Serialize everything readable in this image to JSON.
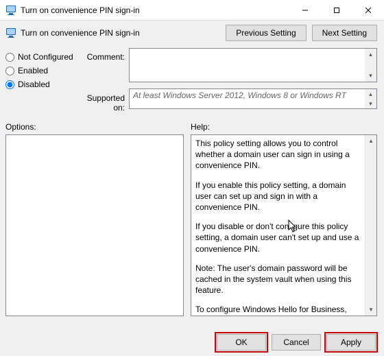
{
  "window": {
    "title": "Turn on convenience PIN sign-in"
  },
  "header": {
    "policy_name": "Turn on convenience PIN sign-in",
    "prev_btn": "Previous Setting",
    "next_btn": "Next Setting"
  },
  "state_options": {
    "not_configured": "Not Configured",
    "enabled": "Enabled",
    "disabled": "Disabled",
    "selected": "disabled"
  },
  "labels": {
    "comment": "Comment:",
    "supported": "Supported on:",
    "options": "Options:",
    "help": "Help:"
  },
  "comment_value": "",
  "supported_text": "At least Windows Server 2012, Windows 8 or Windows RT",
  "help": {
    "p1": "This policy setting allows you to control whether a domain user can sign in using a convenience PIN.",
    "p2": "If you enable this policy setting, a domain user can set up and sign in with a convenience PIN.",
    "p3": "If you disable or don't configure this policy setting, a domain user can't set up and use a convenience PIN.",
    "p4": "Note: The user's domain password will be cached in the system vault when using this feature.",
    "p5": "To configure Windows Hello for Business, use the Administrative Template policies under Windows Hello for Business."
  },
  "footer": {
    "ok": "OK",
    "cancel": "Cancel",
    "apply": "Apply"
  }
}
